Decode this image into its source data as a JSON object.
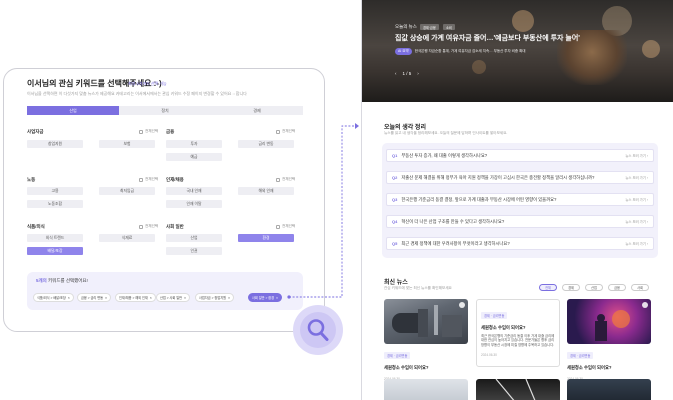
{
  "left": {
    "title": "이서님의 관심 키워드를 선택해주세요 :-)",
    "title_sub": "최대 5개까지 선택 가능",
    "desc": "이서님을 선택하면 이 다섯가지 맞춤 뉴스가 제공해요 카테고리는 이서에서에서는 관심 키워드 수정 페이지 변경할 수 있어요 :: 합니다",
    "tabs": [
      "산업",
      "정치",
      "경제"
    ],
    "check_all": "전체선택",
    "categories": [
      {
        "name": "사업자금",
        "items": [
          "창업지원",
          "보험"
        ]
      },
      {
        "name": "금융",
        "items": [
          "투자",
          "금리 변동",
          "예금"
        ]
      },
      {
        "name": "노동",
        "items": [
          "고용",
          "최저임금",
          "노동조합"
        ]
      },
      {
        "name": "인재/채용",
        "items": [
          "국내 인재",
          "해외 인재",
          "인재 이탈"
        ]
      },
      {
        "name": "식품/외식",
        "items": [
          "외식 트렌드",
          "식재료",
          "배달/포장"
        ]
      },
      {
        "name": "사회 일반",
        "items": [
          "산업",
          "환경",
          "인권"
        ]
      }
    ],
    "selected_box": {
      "title_accent": "5개의",
      "title_rest": " 키워드를 선택했어요!",
      "chips": [
        "식품/외식 > 배달/포장",
        "금융 > 금리 변동",
        "인재/채용 > 해외 인재",
        "산업 > 사회 일반",
        "사업자금 > 창업지원",
        "사회 일반 > 환경"
      ]
    }
  },
  "right": {
    "hero": {
      "kicker": "오늘의 뉴스",
      "badges": [
        "경제·금융",
        "소비"
      ],
      "headline": "집값 상승에 가계 여유자금 줄어…'예금보다 부동산에 투자 늘어'",
      "sub_pill": "AI 요약",
      "sub_text": "한국은행 자금순환 통계, 가계 여유자금 감소세 지속… 부동산 투자 비중 확대",
      "pager": [
        "‹",
        "1 / 5",
        "›"
      ]
    },
    "thoughts": {
      "title": "오늘의 생각 정리",
      "desc": "뉴스를 읽고 내 생각을 정리해보세요. 오늘의 질문에 답하며 인사이트를 쌓아보세요.",
      "questions": [
        {
          "no": "Q1",
          "text": "부동산 투자 증가, 왜 대출 이렇게 생각하시나요?",
          "meta": "뉴스 보러 가기"
        },
        {
          "no": "Q2",
          "text": "저출산 문제 해결을 위해 정부가 육아 지원 정책을 가장이 고심시 한국은 충전할 정책을 알리시 생각하십니까?",
          "meta": "뉴스 보러 가기"
        },
        {
          "no": "Q3",
          "text": "한국은행 기준금리 동결 결정, 앞으로 가계 대출과 부동산 시장에 어떤 영향이 있을까요?",
          "meta": "뉴스 보러 가기"
        },
        {
          "no": "Q4",
          "text": "혁신이 더 나은 산업 구조를 만들 수 있다고 생각하시나요?",
          "meta": "뉴스 보러 가기"
        },
        {
          "no": "Q5",
          "text": "최근 경제 정책에 대한 우려사항이 무엇이라고 생각하시나요?",
          "meta": "뉴스 보러 가기"
        }
      ]
    },
    "latest": {
      "title": "최신 뉴스",
      "desc": "관심 키워드에 맞는 최신 뉴스를 확인해보세요",
      "filters": [
        "전체",
        "경제",
        "산업",
        "금융",
        "사회"
      ],
      "cards": [
        {
          "tag": "경제 · 금리변동",
          "title": "세원청소 수입이 되어요?",
          "date": "2024.06.30"
        },
        {
          "tag": "경제 · 금리변동",
          "title": "세원청소 수입이 되어요?",
          "text": "최근 한국은행의 기준금리 동결 이후 가계 대출 금리에 대한 관심이 높아지고 있습니다. 전문가들은 향후 금리 방향이 부동산 시장에 미칠 영향에 주목하고 있습니다.",
          "date": "2024.06.30"
        },
        {
          "tag": "경제 · 금리변동",
          "title": "세원청소 수입이 되어요?",
          "date": "2024.06.30"
        }
      ]
    }
  },
  "colors": {
    "accent": "#7b6fe0",
    "accent_light": "#efeefc"
  }
}
